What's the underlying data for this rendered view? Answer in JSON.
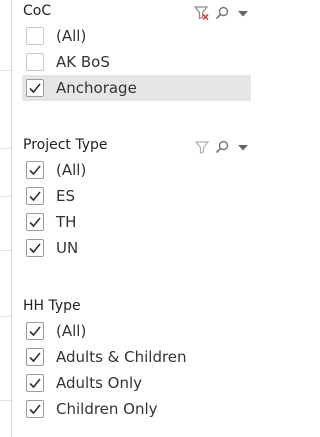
{
  "filters": [
    {
      "title": "CoC",
      "items": [
        {
          "label": "(All)",
          "checked": false
        },
        {
          "label": "AK BoS",
          "checked": false
        },
        {
          "label": "Anchorage",
          "checked": true,
          "selected": true
        }
      ]
    },
    {
      "title": "Project Type",
      "items": [
        {
          "label": "(All)",
          "checked": true
        },
        {
          "label": "ES",
          "checked": true
        },
        {
          "label": "TH",
          "checked": true
        },
        {
          "label": "UN",
          "checked": true
        }
      ]
    },
    {
      "title": "HH Type",
      "items": [
        {
          "label": "(All)",
          "checked": true
        },
        {
          "label": "Adults & Children",
          "checked": true
        },
        {
          "label": "Adults Only",
          "checked": true
        },
        {
          "label": "Children Only",
          "checked": true
        }
      ]
    }
  ],
  "icons": {
    "clear_filter": "clear-filter-icon",
    "filter": "filter-icon",
    "search": "search-icon",
    "menu": "dropdown-arrow-icon"
  },
  "colors": {
    "clear_filter_x": "#d9463b",
    "selected_row": "#e6e6e6"
  }
}
